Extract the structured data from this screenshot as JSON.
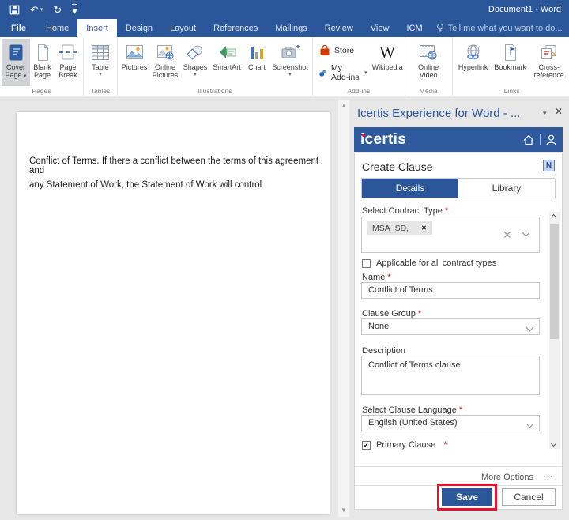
{
  "window": {
    "title": "Document1 - Word"
  },
  "menu": {
    "tabs": [
      "File",
      "Home",
      "Insert",
      "Design",
      "Layout",
      "References",
      "Mailings",
      "Review",
      "View",
      "ICM"
    ],
    "selected_tab": "Insert",
    "tell_me": "Tell me what you want to do..."
  },
  "ribbon": {
    "groups": [
      {
        "label": "Pages",
        "items": [
          {
            "line1": "Cover",
            "line2": "Page",
            "dropdown": true,
            "selected": true
          },
          {
            "line1": "Blank",
            "line2": "Page"
          },
          {
            "line1": "Page",
            "line2": "Break"
          }
        ]
      },
      {
        "label": "Tables",
        "items": [
          {
            "line1": "Table",
            "dropdown": true
          }
        ]
      },
      {
        "label": "Illustrations",
        "items": [
          {
            "line1": "Pictures"
          },
          {
            "line1": "Online",
            "line2": "Pictures"
          },
          {
            "line1": "Shapes",
            "dropdown": true
          },
          {
            "line1": "SmartArt"
          },
          {
            "line1": "Chart"
          },
          {
            "line1": "Screenshot",
            "dropdown": true
          }
        ]
      },
      {
        "label": "Add-ins",
        "small_items": [
          {
            "label": "Store"
          },
          {
            "label": "My Add-ins",
            "dropdown": true
          }
        ],
        "items": [
          {
            "line1": "Wikipedia"
          }
        ]
      },
      {
        "label": "Media",
        "items": [
          {
            "line1": "Online",
            "line2": "Video"
          }
        ]
      },
      {
        "label": "Links",
        "items": [
          {
            "line1": "Hyperlink"
          },
          {
            "line1": "Bookmark"
          },
          {
            "line1": "Cross-",
            "line2": "reference"
          }
        ]
      }
    ]
  },
  "document": {
    "line1": "Conflict of Terms. If there a conflict between the terms of this agreement and",
    "line2": "any Statement of Work, the Statement of Work will control"
  },
  "panel": {
    "window_title": "Icertis Experience for Word - ...",
    "brand": "icertis",
    "heading": "Create Clause",
    "tabs": {
      "details": "Details",
      "library": "Library"
    },
    "form": {
      "contract_type": {
        "label": "Select Contract Type",
        "required": "*",
        "chip": "MSA_SD,"
      },
      "applicable_checkbox": {
        "label": "Applicable for all contract types",
        "checked": false
      },
      "name": {
        "label": "Name",
        "required": "*",
        "value": "Conflict of Terms"
      },
      "clause_group": {
        "label": "Clause Group",
        "required": "*",
        "value": "None"
      },
      "description": {
        "label": "Description",
        "value": "Conflict of Terms clause"
      },
      "language": {
        "label": "Select Clause Language",
        "required": "*",
        "value": "English (United States)"
      },
      "primary_checkbox": {
        "label": "Primary Clause",
        "required": "*",
        "checked": true
      }
    },
    "more_options": "More Options",
    "save_label": "Save",
    "cancel_label": "Cancel"
  },
  "icons": {
    "dropdown_caret": "▾",
    "close": "✕",
    "clear": "✕",
    "chip_remove": "✕",
    "ellipsis": "⋯",
    "check": "✓",
    "undo": "↶",
    "redo": "↻",
    "wikipedia_w": "W",
    "up_arrow": "▲",
    "down_arrow": "▼"
  },
  "colors": {
    "accent_blue": "#2B579A",
    "brandbar_blue": "#2F5A9D",
    "save_highlight_red": "#E8112D",
    "required_red": "#C00000",
    "store_orange": "#D83B01",
    "workspace_gray": "#E7E7E7"
  }
}
